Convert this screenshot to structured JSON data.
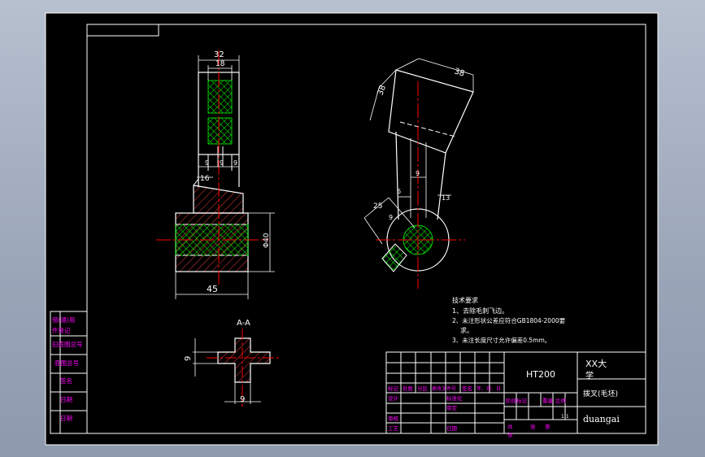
{
  "colors": {
    "background": "#000000",
    "frame": "#ffffff",
    "outline": "#ffffff",
    "hatch": "#00ff00",
    "hatch_alt": "#ff3b3b",
    "centerline": "#ff0000",
    "dimension": "#ffffff",
    "magenta_text": "#ff00ff",
    "outer_bg": "#a6b0c2"
  },
  "drawing": {
    "dimensions": {
      "front_width_top": "32",
      "front_width_inner": "18",
      "front_neck_a": "9",
      "front_neck_b": "9",
      "front_neck_c": "9",
      "front_step": "16",
      "front_diameter": "Φ40",
      "front_base_width": "45",
      "side_top_a": "38",
      "side_top_b": "38",
      "side_neck": "9",
      "side_offset": "6",
      "side_radius": "25",
      "side_small": "9",
      "side_right": "13",
      "section_height": "9",
      "section_width": "9"
    },
    "section_label": "A-A"
  },
  "notes": {
    "title": "技术要求",
    "lines": [
      "1、去除毛刺飞边。",
      "2、未注形状公差应符合GB1804-2000要",
      "求。",
      "3、未注长度尺寸允许偏差0.5mm。"
    ]
  },
  "title_block": {
    "material": "HT200",
    "school": "XX大",
    "school_line2": "学",
    "part_name": "拨叉(毛坯)",
    "signature": "duangai",
    "scale_label": "1:1",
    "header_cells": [
      "标记",
      "处数",
      "分区",
      "更改文件号",
      "签名",
      "年、月、日"
    ],
    "row_labels": [
      "设计",
      "审核",
      "工艺"
    ],
    "mid_labels": [
      "标准化",
      "审定",
      "日期"
    ],
    "stage_labels": [
      "阶段标记",
      "重量",
      "比例"
    ],
    "sheet_labels": [
      "共",
      "张",
      "第",
      "张"
    ]
  },
  "left_table": [
    "借(通)用",
    "件登记",
    "旧底图总号",
    "底图总号",
    "签名",
    "日期",
    "日期"
  ],
  "top_left_box": ""
}
